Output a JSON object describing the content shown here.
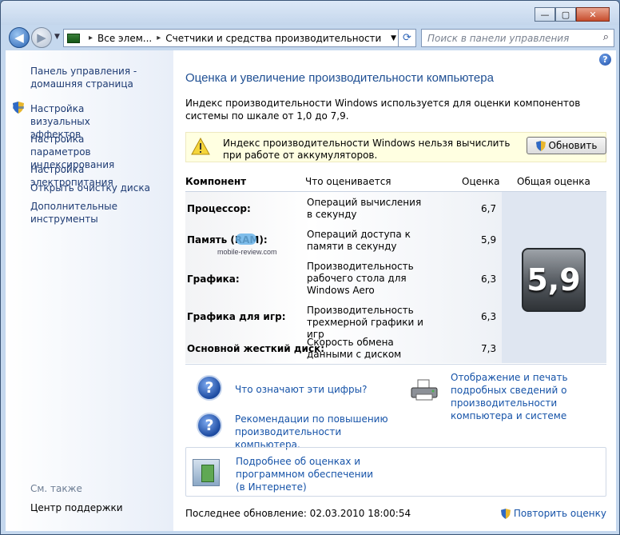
{
  "nav": {
    "address_parts": [
      "Все элем...",
      "Счетчики и средства производительности"
    ],
    "search_placeholder": "Поиск в панели управления"
  },
  "sidebar": {
    "home_link": "Панель управления - домашняя страница",
    "tasks": [
      "Настройка визуальных эффектов",
      "Настройка параметров индексирования",
      "Настройка электропитания",
      "Открыть очистку диска",
      "Дополнительные инструменты"
    ],
    "see_also_label": "См. также",
    "see_also_items": [
      "Центр поддержки"
    ]
  },
  "main": {
    "title": "Оценка и увеличение производительности компьютера",
    "description": "Индекс производительности Windows используется для оценки компонентов системы по шкале от 1,0 до 7,9.",
    "warning": "Индекс производительности Windows нельзя вычислить при работе от аккумуляторов.",
    "update_button": "Обновить",
    "table": {
      "headers": {
        "component": "Компонент",
        "what": "Что оценивается",
        "score": "Оценка",
        "overall": "Общая оценка"
      },
      "rows": [
        {
          "component": "Процессор:",
          "what": "Операций вычисления в секунду",
          "score": "6,7"
        },
        {
          "component": "Память (RAM):",
          "what": "Операций доступа к памяти в секунду",
          "score": "5,9"
        },
        {
          "component": "Графика:",
          "what": "Производительность рабочего стола для Windows Aero",
          "score": "6,3"
        },
        {
          "component": "Графика для игр:",
          "what": "Производительность трехмерной графики и игр",
          "score": "6,3"
        },
        {
          "component": "Основной жесткий диск:",
          "what": "Скорость обмена данными с диском",
          "score": "7,3"
        }
      ],
      "overall_score": "5,9"
    },
    "watermark": "mobile-review.com",
    "links": {
      "what_numbers": "Что означают эти цифры?",
      "recommendations": "Рекомендации по повышению производительности компьютера.",
      "print_details": "Отображение и печать подробных сведений о производительности компьютера и системе",
      "more_info": "Подробнее об оценках и программном обеспечении (в Интернете)"
    },
    "last_update": "Последнее обновление: 02.03.2010 18:00:54",
    "rerun": "Повторить оценку"
  }
}
